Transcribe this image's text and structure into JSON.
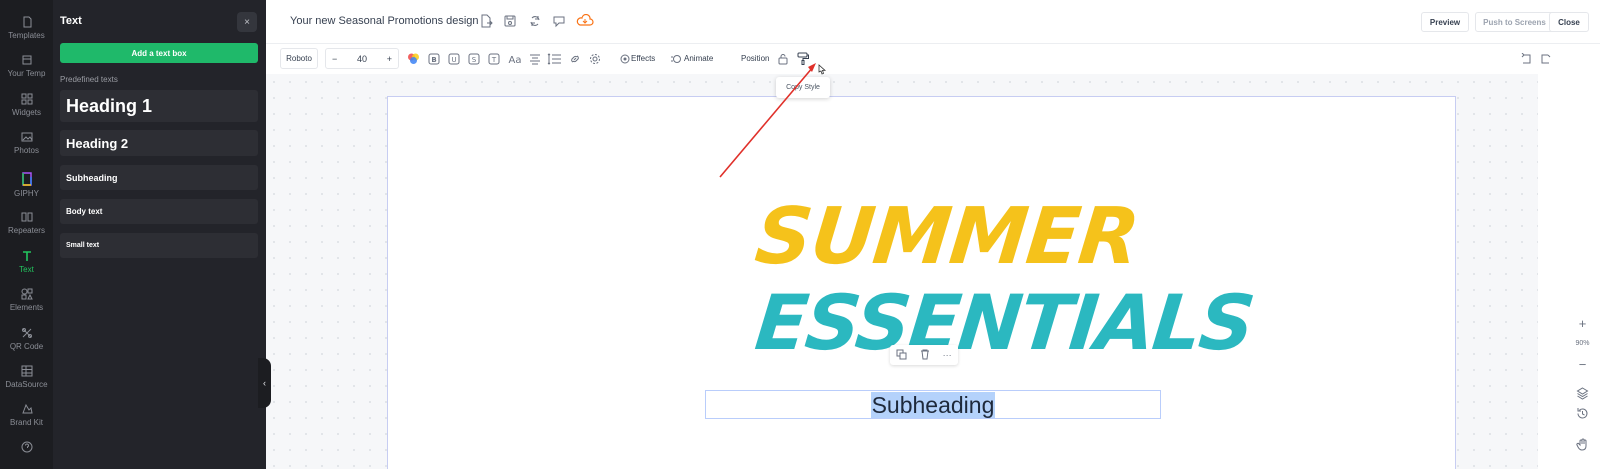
{
  "rail": {
    "items": [
      {
        "label": "Templates",
        "icon": "templates-icon"
      },
      {
        "label": "Your Temp",
        "icon": "your-templates-icon"
      },
      {
        "label": "Widgets",
        "icon": "widgets-icon"
      },
      {
        "label": "Photos",
        "icon": "photos-icon"
      },
      {
        "label": "GIPHY",
        "icon": "giphy-icon"
      },
      {
        "label": "Repeaters",
        "icon": "repeaters-icon"
      },
      {
        "label": "Text",
        "icon": "text-icon",
        "active": true
      },
      {
        "label": "Elements",
        "icon": "elements-icon"
      },
      {
        "label": "QR Code",
        "icon": "qr-code-icon"
      },
      {
        "label": "DataSource",
        "icon": "datasource-icon"
      },
      {
        "label": "Brand Kit",
        "icon": "brand-kit-icon"
      }
    ]
  },
  "panel": {
    "title": "Text",
    "close": "×",
    "add_button": "Add a text box",
    "predefined_label": "Predefined texts",
    "items": [
      "Heading 1",
      "Heading 2",
      "Subheading",
      "Body text",
      "Small text"
    ]
  },
  "header": {
    "doc_title": "Your new Seasonal Promotions design",
    "preview": "Preview",
    "push": "Push to Screens",
    "close": "Close"
  },
  "toolbar": {
    "font": "Roboto",
    "minus": "−",
    "size": "40",
    "plus": "+",
    "effects": "Effects",
    "animate": "Animate",
    "position": "Position",
    "tooltip": "Copy Style"
  },
  "canvas": {
    "line1": "SUMMER",
    "line2": "ESSENTIALS",
    "subheading": "Subheading",
    "more": "···"
  },
  "zoom": {
    "plus": "+",
    "value": "90%",
    "minus": "−"
  },
  "colors": {
    "accent_green": "#1fb96a",
    "summer_yellow": "#f5c21b",
    "essentials_teal": "#2bb8c0",
    "cloud_orange": "#f97316"
  }
}
